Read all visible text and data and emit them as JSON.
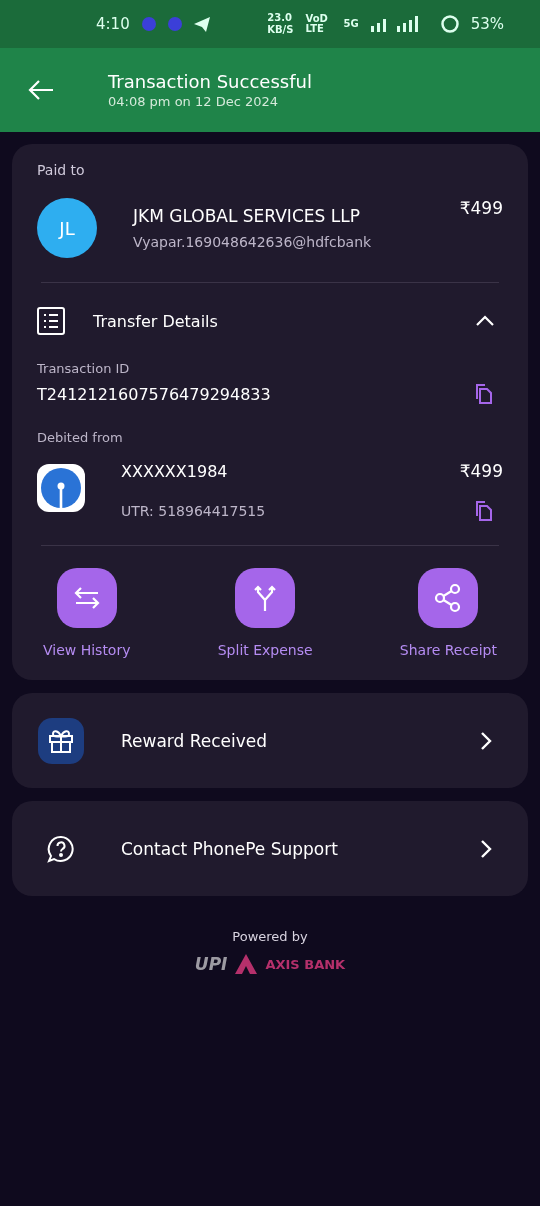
{
  "status_bar": {
    "time": "4:10",
    "speed": "23.0",
    "speed_unit": "KB/S",
    "network": "VoD LTE",
    "generation": "5G",
    "battery": "53%"
  },
  "header": {
    "title": "Transaction Successful",
    "subtitle": "04:08 pm on 12 Dec 2024"
  },
  "payee": {
    "label": "Paid to",
    "initials": "JL",
    "name": "JKM GLOBAL SERVICES LLP",
    "upi_id": "Vyapar.169048642636@hdfcbank",
    "amount": "₹499"
  },
  "transfer_details": {
    "title": "Transfer Details",
    "expanded": true,
    "transaction_id_label": "Transaction ID",
    "transaction_id": "T2412121607576479294833",
    "debited_label": "Debited from",
    "account": "XXXXXX1984",
    "amount": "₹499",
    "utr": "UTR: 518964417515"
  },
  "actions": [
    {
      "kind": "history",
      "label": "View History"
    },
    {
      "kind": "split",
      "label": "Split Expense"
    },
    {
      "kind": "share",
      "label": "Share Receipt"
    }
  ],
  "links": [
    {
      "kind": "reward",
      "label": "Reward Received"
    },
    {
      "kind": "support",
      "label": "Contact PhonePe Support"
    }
  ],
  "footer": {
    "powered_by": "Powered by",
    "upi": "UPI",
    "bank": "AXIS BANK"
  }
}
